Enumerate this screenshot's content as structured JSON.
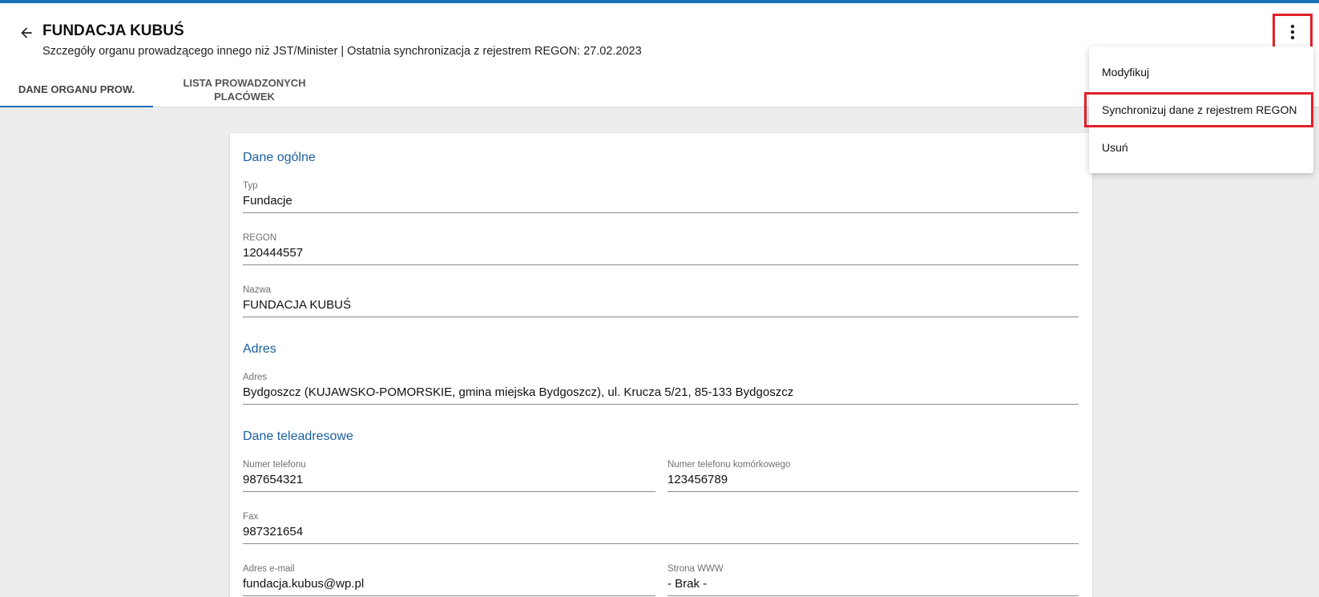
{
  "header": {
    "title": "FUNDACJA KUBUŚ",
    "subtitle": "Szczegóły organu prowadzącego innego niż JST/Minister | Ostatnia synchronizacja z rejestrem REGON: 27.02.2023"
  },
  "tabs": [
    {
      "label": "DANE ORGANU PROW.",
      "active": true
    },
    {
      "label": "LISTA PROWADZONYCH PLACÓWEK",
      "active": false
    }
  ],
  "menu": {
    "items": [
      {
        "label": "Modyfikuj"
      },
      {
        "label": "Synchronizuj dane z rejestrem REGON"
      },
      {
        "label": "Usuń"
      }
    ]
  },
  "sections": {
    "general": {
      "title": "Dane ogólne",
      "typ": {
        "label": "Typ",
        "value": "Fundacje"
      },
      "regon": {
        "label": "REGON",
        "value": "120444557"
      },
      "nazwa": {
        "label": "Nazwa",
        "value": "FUNDACJA KUBUŚ"
      }
    },
    "address": {
      "title": "Adres",
      "adres": {
        "label": "Adres",
        "value": "Bydgoszcz (KUJAWSKO-POMORSKIE, gmina miejska Bydgoszcz), ul. Krucza 5/21, 85-133 Bydgoszcz"
      }
    },
    "contact": {
      "title": "Dane teleadresowe",
      "phone": {
        "label": "Numer telefonu",
        "value": "987654321"
      },
      "mobile": {
        "label": "Numer telefonu komórkowego",
        "value": "123456789"
      },
      "fax": {
        "label": "Fax",
        "value": "987321654"
      },
      "email": {
        "label": "Adres e-mail",
        "value": "fundacja.kubus@wp.pl"
      },
      "www": {
        "label": "Strona WWW",
        "value": "- Brak -"
      }
    }
  },
  "colors": {
    "accent": "#1a6fb5",
    "section_title": "#1a5f9e",
    "highlight_border": "#e0202a"
  },
  "icons": {
    "back": "arrow-left-icon",
    "menu": "more-vert-icon"
  }
}
